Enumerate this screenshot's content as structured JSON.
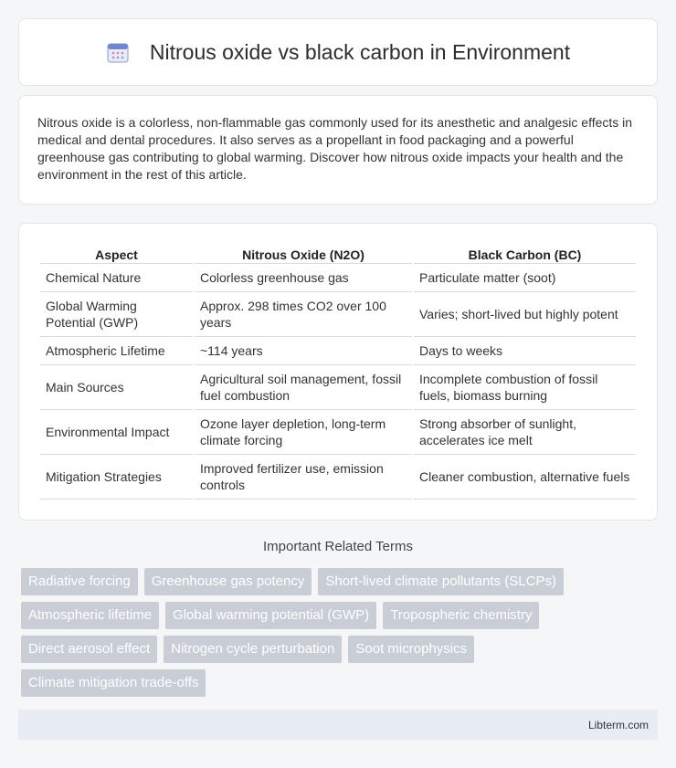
{
  "header": {
    "title": "Nitrous oxide vs black carbon in Environment",
    "icon": "calendar-icon"
  },
  "intro": {
    "text": "Nitrous oxide is a colorless, non-flammable gas commonly used for its anesthetic and analgesic effects in medical and dental procedures. It also serves as a propellant in food packaging and a powerful greenhouse gas contributing to global warming. Discover how nitrous oxide impacts your health and the environment in the rest of this article."
  },
  "table": {
    "headers": [
      "Aspect",
      "Nitrous Oxide (N2O)",
      "Black Carbon (BC)"
    ],
    "rows": [
      [
        "Chemical Nature",
        "Colorless greenhouse gas",
        "Particulate matter (soot)"
      ],
      [
        "Global Warming Potential (GWP)",
        "Approx. 298 times CO2 over 100 years",
        "Varies; short-lived but highly potent"
      ],
      [
        "Atmospheric Lifetime",
        "~114 years",
        "Days to weeks"
      ],
      [
        "Main Sources",
        "Agricultural soil management, fossil fuel combustion",
        "Incomplete combustion of fossil fuels, biomass burning"
      ],
      [
        "Environmental Impact",
        "Ozone layer depletion, long-term climate forcing",
        "Strong absorber of sunlight, accelerates ice melt"
      ],
      [
        "Mitigation Strategies",
        "Improved fertilizer use, emission controls",
        "Cleaner combustion, alternative fuels"
      ]
    ]
  },
  "related": {
    "title": "Important Related Terms",
    "tags": [
      "Radiative forcing",
      "Greenhouse gas potency",
      "Short-lived climate pollutants (SLCPs)",
      "Atmospheric lifetime",
      "Global warming potential (GWP)",
      "Tropospheric chemistry",
      "Direct aerosol effect",
      "Nitrogen cycle perturbation",
      "Soot microphysics",
      "Climate mitigation trade-offs"
    ]
  },
  "footer": {
    "text": "Libterm.com"
  }
}
